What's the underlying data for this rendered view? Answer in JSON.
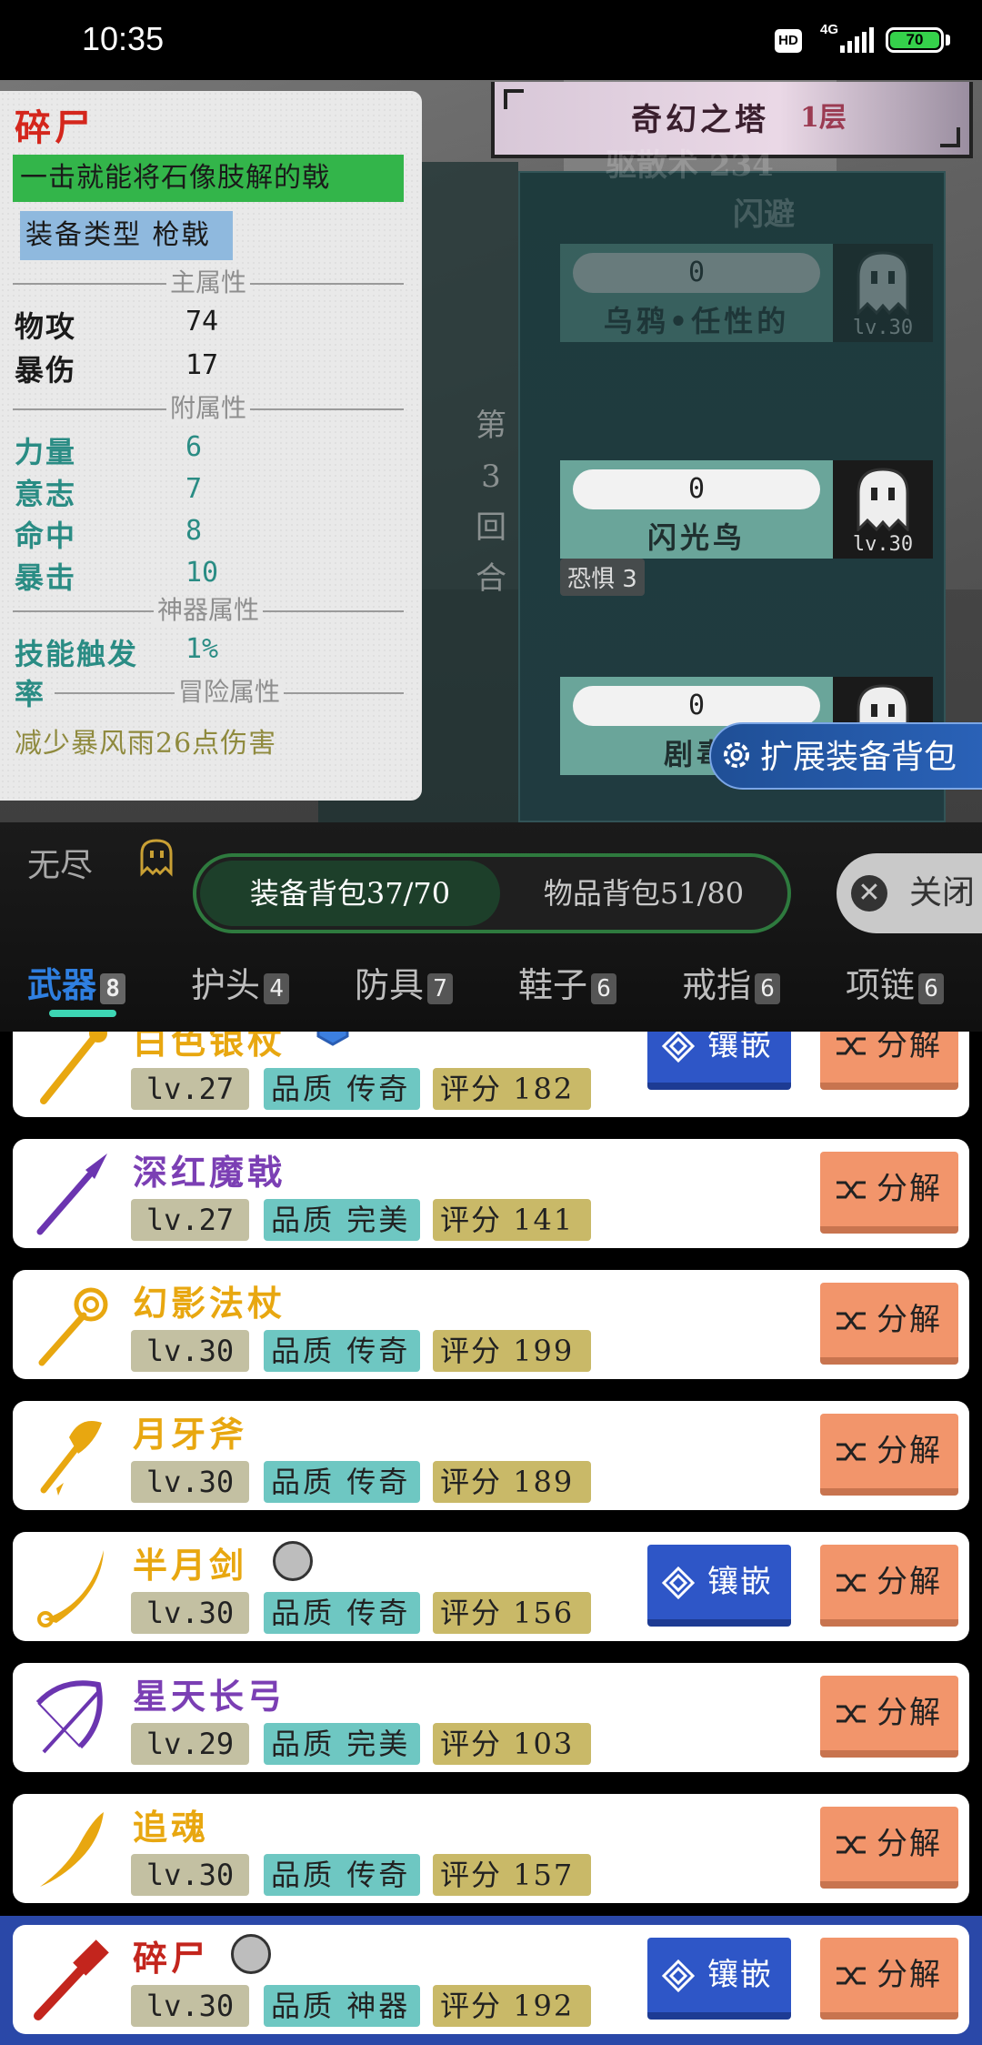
{
  "status": {
    "time": "10:35",
    "hd": "HD",
    "network": "4G",
    "battery": "70"
  },
  "tower": {
    "title": "奇幻之塔",
    "floor": "1层"
  },
  "ghost_text": {
    "line1": "驱散术 234",
    "line2": "闪避",
    "enemy_top_name": "乌鸦•任性的",
    "enemy_top_hp": "0",
    "enemy_top_lv": "lv.30"
  },
  "battle": {
    "round_text": [
      "第",
      "3",
      "回",
      "合"
    ],
    "enemies": [
      {
        "hp": "0",
        "name": "闪光鸟",
        "lv": "lv.30"
      },
      {
        "hp": "0",
        "name": "剧毒",
        "lv": ""
      }
    ],
    "fear_tag": "恐惧 3"
  },
  "expand_button": "扩展装备背包",
  "tooltip": {
    "name": "碎尸",
    "desc": "一击就能将石像肢解的戟",
    "type": "装备类型 枪戟",
    "sections": {
      "main": "主属性",
      "sub": "附属性",
      "artifact": "神器属性",
      "adventure": "冒险属性"
    },
    "main_stats": [
      {
        "label": "物攻",
        "value": "74"
      },
      {
        "label": "暴伤",
        "value": "17"
      }
    ],
    "sub_stats": [
      {
        "label": "力量",
        "value": "6"
      },
      {
        "label": "意志",
        "value": "7"
      },
      {
        "label": "命中",
        "value": "8"
      },
      {
        "label": "暴击",
        "value": "10"
      }
    ],
    "artifact_stat": {
      "label": "技能触发",
      "label2": "率",
      "value": "1%"
    },
    "adventure_text": "减少暴风雨26点伤害"
  },
  "panel": {
    "endless": "无尽",
    "bag_equipment": "装备背包37/70",
    "bag_items": "物品背包51/80",
    "close": "关闭"
  },
  "tabs": [
    {
      "label": "武器",
      "count": "8"
    },
    {
      "label": "护头",
      "count": "4"
    },
    {
      "label": "防具",
      "count": "7"
    },
    {
      "label": "鞋子",
      "count": "6"
    },
    {
      "label": "戒指",
      "count": "6"
    },
    {
      "label": "项链",
      "count": "6"
    }
  ],
  "labels": {
    "inlay": "镶嵌",
    "decompose": "分解",
    "quality": "品质",
    "score": "评分"
  },
  "items": [
    {
      "name": "白色银杖",
      "lv": "lv.27",
      "quality": "传奇",
      "score": "182",
      "inlay": true,
      "color": "gold",
      "icon": "staff-icon"
    },
    {
      "name": "深红魔戟",
      "lv": "lv.27",
      "quality": "完美",
      "score": "141",
      "inlay": false,
      "color": "purple",
      "icon": "spear-icon"
    },
    {
      "name": "幻影法杖",
      "lv": "lv.30",
      "quality": "传奇",
      "score": "199",
      "inlay": false,
      "color": "gold",
      "icon": "magic-staff-icon"
    },
    {
      "name": "月牙斧",
      "lv": "lv.30",
      "quality": "传奇",
      "score": "189",
      "inlay": false,
      "color": "gold",
      "icon": "axe-icon"
    },
    {
      "name": "半月剑",
      "lv": "lv.30",
      "quality": "传奇",
      "score": "156",
      "inlay": true,
      "color": "gold",
      "icon": "crescent-sword-icon"
    },
    {
      "name": "星天长弓",
      "lv": "lv.29",
      "quality": "完美",
      "score": "103",
      "inlay": false,
      "color": "purple",
      "icon": "bow-icon"
    },
    {
      "name": "追魂",
      "lv": "lv.30",
      "quality": "传奇",
      "score": "157",
      "inlay": false,
      "color": "gold",
      "icon": "blade-icon"
    },
    {
      "name": "碎尸",
      "lv": "lv.30",
      "quality": "神器",
      "score": "192",
      "inlay": true,
      "color": "red",
      "icon": "halberd-icon"
    }
  ],
  "colors": {
    "accent": "#2f7fe0",
    "legendary": "#e8a710",
    "perfect": "#7b3fb4",
    "artifact": "#c3251d"
  }
}
